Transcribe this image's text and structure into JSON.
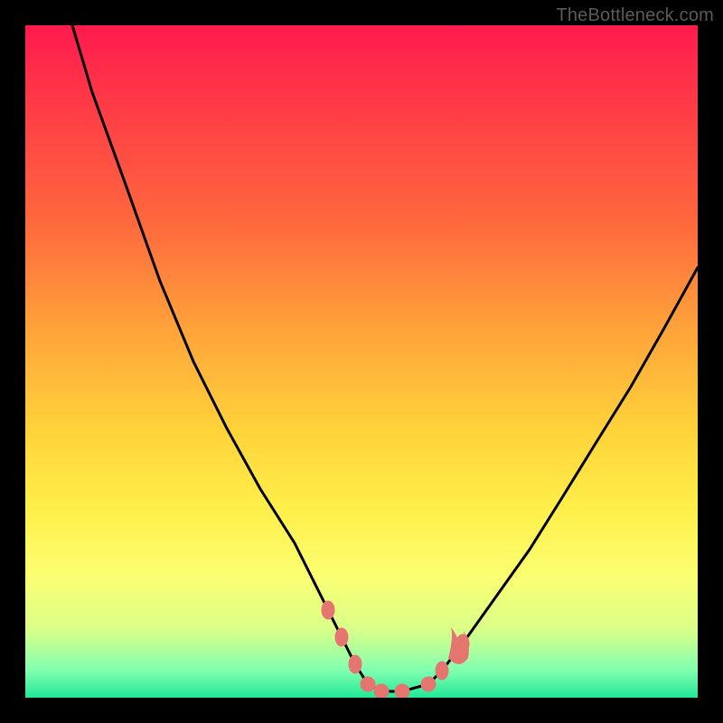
{
  "watermark": "TheBottleneck.com",
  "chart_data": {
    "type": "line",
    "title": "",
    "xlabel": "",
    "ylabel": "",
    "xlim": [
      0,
      100
    ],
    "ylim": [
      0,
      100
    ],
    "series": [
      {
        "name": "curve",
        "x": [
          7,
          10,
          15,
          20,
          25,
          30,
          35,
          40,
          45,
          47,
          49,
          51,
          53,
          56,
          60,
          62,
          65,
          70,
          75,
          80,
          85,
          90,
          95,
          100
        ],
        "y": [
          100,
          90,
          76,
          62,
          50,
          40,
          31,
          23,
          13,
          9,
          5,
          2,
          1,
          1,
          2,
          4,
          8,
          15,
          22,
          30,
          38,
          46,
          55,
          64
        ]
      }
    ],
    "markers": [
      {
        "name": "pink-dot",
        "x": 45,
        "y": 13
      },
      {
        "name": "pink-dot",
        "x": 47,
        "y": 9
      },
      {
        "name": "pink-dot",
        "x": 49,
        "y": 5
      },
      {
        "name": "pink-dot",
        "x": 51,
        "y": 2
      },
      {
        "name": "pink-dot",
        "x": 53,
        "y": 1
      },
      {
        "name": "pink-dot",
        "x": 56,
        "y": 1
      },
      {
        "name": "pink-dot",
        "x": 60,
        "y": 2
      },
      {
        "name": "pink-dot",
        "x": 62,
        "y": 4
      },
      {
        "name": "pink-dot",
        "x": 65,
        "y": 8
      },
      {
        "name": "pink-brush",
        "x": 63,
        "y": 6
      }
    ],
    "colors": {
      "curve": "#000000",
      "markers": "#e5766f",
      "gradient_top": "#ff1a4d",
      "gradient_bottom": "#21e896"
    }
  }
}
